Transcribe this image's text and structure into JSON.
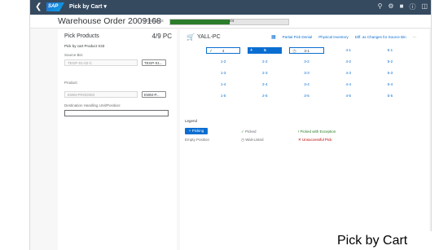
{
  "shell": {
    "app_title": "Pick by Cart ▾",
    "logo_text": "SAP",
    "back_icon": "back-arrow-icon",
    "icons": [
      "search-icon",
      "settings-icon",
      "notifications-icon",
      "help-icon",
      "user-icon"
    ]
  },
  "header": {
    "title": "Warehouse Order 2009168",
    "steps_label": "Pick Steps",
    "progress_text": "2/4",
    "progress_fraction": 0.5,
    "progress_color": "#2b7d2b"
  },
  "left_panel": {
    "title": "Pick Products",
    "count": "4/9 PC",
    "subtitle": "Pick by cart Product X33",
    "source_bin_label": "Source Bin:",
    "source_bin_value": "TEGP-01-02-C",
    "source_bin_button": "TEGP-01...",
    "product_label": "Product:",
    "product_value": "EWM-PROD003",
    "product_button": "EWM-P...",
    "dest_label": "Destination Handling Unit/Position:"
  },
  "right_panel": {
    "cart_name": "YALL-PC",
    "toolbar": {
      "partial_pick": "Partial Pick Denial",
      "physical_inventory": "Physical Inventory",
      "diff_as_changes": "Diff. as Changes for Source Bin",
      "more": "···"
    },
    "grid": [
      [
        {
          "label": "4",
          "state": "done"
        },
        {
          "label": "5",
          "state": "active"
        },
        {
          "label": "3-1",
          "state": "waiting"
        },
        {
          "label": "4-1",
          "state": "empty"
        },
        {
          "label": "5-1",
          "state": "empty"
        }
      ],
      [
        {
          "label": "1-2",
          "state": "empty"
        },
        {
          "label": "2-2",
          "state": "empty"
        },
        {
          "label": "3-2",
          "state": "empty"
        },
        {
          "label": "4-2",
          "state": "empty"
        },
        {
          "label": "5-2",
          "state": "empty"
        }
      ],
      [
        {
          "label": "1-3",
          "state": "empty"
        },
        {
          "label": "2-3",
          "state": "empty"
        },
        {
          "label": "3-3",
          "state": "empty"
        },
        {
          "label": "4-3",
          "state": "empty"
        },
        {
          "label": "5-3",
          "state": "empty"
        }
      ],
      [
        {
          "label": "1-4",
          "state": "empty"
        },
        {
          "label": "2-4",
          "state": "empty"
        },
        {
          "label": "3-4",
          "state": "empty"
        },
        {
          "label": "4-4",
          "state": "empty"
        },
        {
          "label": "5-4",
          "state": "empty"
        }
      ],
      [
        {
          "label": "1-5",
          "state": "empty"
        },
        {
          "label": "2-5",
          "state": "empty"
        },
        {
          "label": "3-5",
          "state": "empty"
        },
        {
          "label": "4-5",
          "state": "empty"
        },
        {
          "label": "5-5",
          "state": "empty"
        }
      ]
    ],
    "legend": {
      "title": "Legend",
      "picking": "Picking",
      "empty_position": "Empty Position",
      "picked": "Picked",
      "wait_listed": "Wait-Listed",
      "picked_exception": "Picked with Exception",
      "unsuccessful": "Unsuccessful Pick"
    }
  },
  "caption": "Pick by Cart",
  "colors": {
    "shell": "#354a5f",
    "accent": "#0a6ed1",
    "success": "#2b7d2b",
    "error": "#bb0000"
  }
}
